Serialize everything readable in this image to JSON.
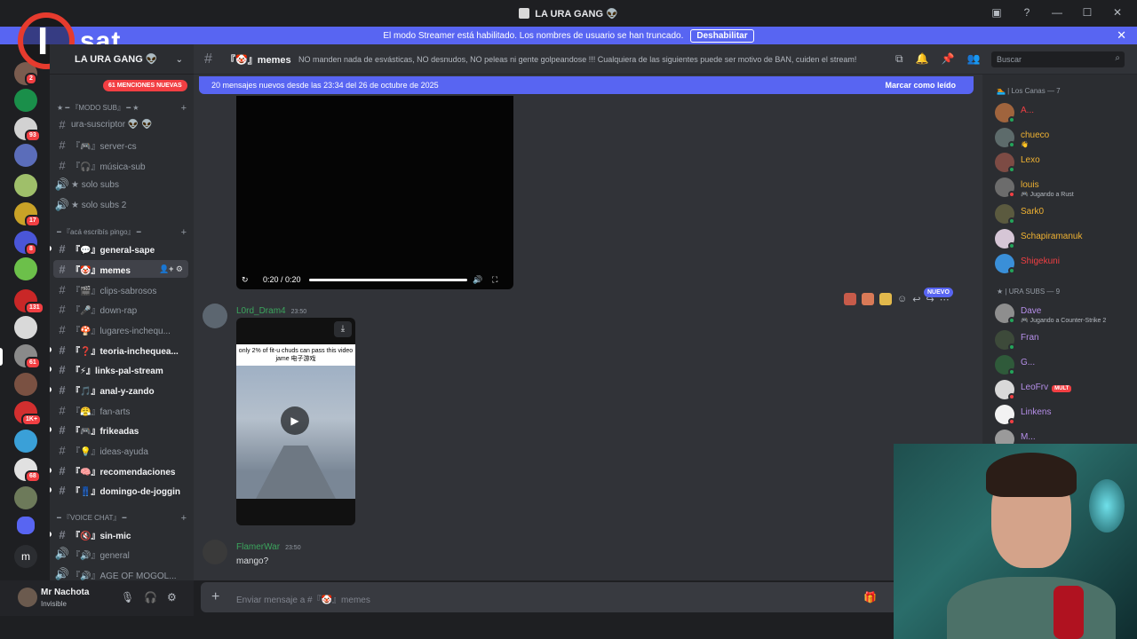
{
  "window": {
    "title": "LA URA GANG 👽",
    "controls": [
      "—",
      "☐",
      "✕"
    ]
  },
  "streamer_banner": {
    "text": "El modo Streamer está habilitado. Los nombres de usuario se han truncado.",
    "button": "Deshabilitar"
  },
  "overlay_logo": {
    "letter": "I",
    "word": "sat"
  },
  "server_badges": [
    "2",
    "93",
    "17",
    "8",
    "131",
    "61",
    "1K+",
    "68"
  ],
  "server": {
    "name": "LA URA GANG 👽",
    "mentions": "61 MENCIONES NUEVAS"
  },
  "channel_list": {
    "categories": [
      {
        "label": "★ ━ 『MODO SUB』 ━ ★"
      },
      {
        "label": "━ 『acá escribís pingo』 ━"
      },
      {
        "label": "━ 『VOICE CHAT』 ━"
      }
    ],
    "channels": [
      {
        "label": "ura-suscriptor 👽 👽",
        "icon": "#"
      },
      {
        "label": "『🎮』server-cs",
        "icon": "#"
      },
      {
        "label": "『🎧』música-sub",
        "icon": "#"
      },
      {
        "label": "★ solo subs",
        "icon": "🔊"
      },
      {
        "label": "★ solo subs 2",
        "icon": "🔊"
      },
      {
        "label": "『💬』general-sape",
        "icon": "#"
      },
      {
        "label": "『🤡』memes",
        "icon": "#"
      },
      {
        "label": "『🎬』clips-sabrosos",
        "icon": "#"
      },
      {
        "label": "『🎤』down-rap",
        "icon": "#"
      },
      {
        "label": "『🍄』lugares-inchequ...",
        "icon": "#"
      },
      {
        "label": "『❓』teoria-inchequea...",
        "icon": "#"
      },
      {
        "label": "『⚡』links-pal-stream",
        "icon": "#"
      },
      {
        "label": "『🎵』anal-y-zando",
        "icon": "#"
      },
      {
        "label": "『😤』fan-arts",
        "icon": "#"
      },
      {
        "label": "『🎮』frikeadas",
        "icon": "#"
      },
      {
        "label": "『💡』ideas-ayuda",
        "icon": "#"
      },
      {
        "label": "『🧠』recomendaciones",
        "icon": "#"
      },
      {
        "label": "『👖』domingo-de-joggin",
        "icon": "#"
      },
      {
        "label": "『🔇』sin-mic",
        "icon": "#"
      },
      {
        "label": "『🔊』general",
        "icon": "🔊"
      },
      {
        "label": "『🔊』AGE OF MOGOL...",
        "icon": "🔊"
      }
    ]
  },
  "user_panel": {
    "name": "Mr Nachota",
    "status": "Invisible"
  },
  "channel_header": {
    "name": "『🤡』memes",
    "topic": "NO manden nada de esvásticas, NO desnudos, NO peleas ni gente golpeandose !!! Cualquiera de las siguientes puede ser motivo de BAN, cuiden el stream!",
    "search_placeholder": "Buscar"
  },
  "new_messages_bar": {
    "text": "20 mensajes nuevos desde las 23:34 del 26 de octubre de 2025",
    "action": "Marcar como leído"
  },
  "video_player": {
    "time": "0:20 / 0:20",
    "progress": 1.0
  },
  "messages": [
    {
      "author": "L0rd_Dram4",
      "time": "23:50",
      "video_caption": "only 2% of fit-u chuds can pass this video jame 电子游戏"
    },
    {
      "author": "FlamerWar",
      "time": "23:50",
      "text": "mango?"
    }
  ],
  "hover_toolbar": {
    "new_badge": "NUEVO"
  },
  "composer": {
    "placeholder": "Enviar mensaje a #『🤡』memes"
  },
  "members": {
    "groups": [
      {
        "label": "🏊 | Los Canas — 7",
        "items": [
          {
            "name": "A...",
            "color": "#f23f43"
          },
          {
            "name": "chueco",
            "activity": "👋",
            "color": "#f0b232"
          },
          {
            "name": "Lexo",
            "color": "#f0b232"
          },
          {
            "name": "louis",
            "activity": "🎮 Jugando a Rust",
            "color": "#f0b232"
          },
          {
            "name": "Sark0",
            "color": "#f0b232"
          },
          {
            "name": "Schapiramanuk",
            "color": "#f0b232"
          },
          {
            "name": "Shigekuni",
            "color": "#f23f43"
          }
        ]
      },
      {
        "label": "★ | URA SUBS — 9",
        "items": [
          {
            "name": "Dave",
            "activity": "🎮 Jugando a Counter-Strike 2",
            "color": "#b58ee8"
          },
          {
            "name": "Fran",
            "color": "#b58ee8"
          },
          {
            "name": "G...",
            "color": "#b58ee8"
          },
          {
            "name": "LeoFrv",
            "tag": "MULT",
            "color": "#b58ee8"
          },
          {
            "name": "Linkens",
            "color": "#b58ee8"
          },
          {
            "name": "M...",
            "color": "#b58ee8"
          }
        ]
      }
    ]
  }
}
